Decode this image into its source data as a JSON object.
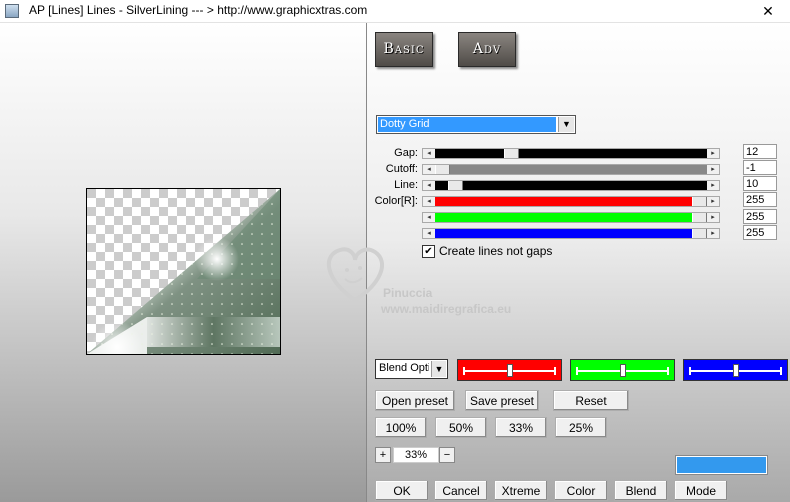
{
  "window": {
    "title": "AP [Lines]  Lines - SilverLining     --- > http://www.graphicxtras.com",
    "close_glyph": "✕"
  },
  "tabs": {
    "basic": "Basic",
    "adv": "Adv"
  },
  "effect_dropdown": {
    "value": "Dotty Grid",
    "arrow": "▼"
  },
  "sliders": [
    {
      "label": "Gap:",
      "value": "12",
      "fill": "#000000",
      "level": 0.27
    },
    {
      "label": "Cutoff:",
      "value": "-1",
      "fill": "#888888",
      "level": 0.0
    },
    {
      "label": "Line:",
      "value": "10",
      "fill": "#000000",
      "level": 0.05
    },
    {
      "label": "Color[R]:",
      "value": "255",
      "fill": "#ff0000",
      "level": 1.0
    },
    {
      "label": "",
      "value": "255",
      "fill": "#00ff00",
      "level": 1.0
    },
    {
      "label": "",
      "value": "255",
      "fill": "#0000ff",
      "level": 1.0
    }
  ],
  "arrows": {
    "left": "◂",
    "right": "▸"
  },
  "checkbox": {
    "label": "Create lines not gaps",
    "checked": true,
    "mark": "✔"
  },
  "watermark": {
    "line1": "Pinuccia",
    "line2": "www.maidiregrafica.eu"
  },
  "blend": {
    "value": "Blend Optio",
    "arrow": "▼"
  },
  "color_boxes": [
    {
      "color": "#ff0000",
      "level": 0.5
    },
    {
      "color": "#00ff00",
      "level": 0.5
    },
    {
      "color": "#0000ff",
      "level": 0.5
    }
  ],
  "preset_buttons": {
    "open": "Open preset",
    "save": "Save preset",
    "reset": "Reset"
  },
  "zoom_buttons": [
    "100%",
    "50%",
    "33%",
    "25%"
  ],
  "zoom": {
    "plus": "+",
    "minus": "−",
    "value": "33%"
  },
  "swatch_color": "#3399ee",
  "bottom_buttons": [
    "OK",
    "Cancel",
    "Xtreme",
    "Color",
    "Blend",
    "Mode"
  ]
}
